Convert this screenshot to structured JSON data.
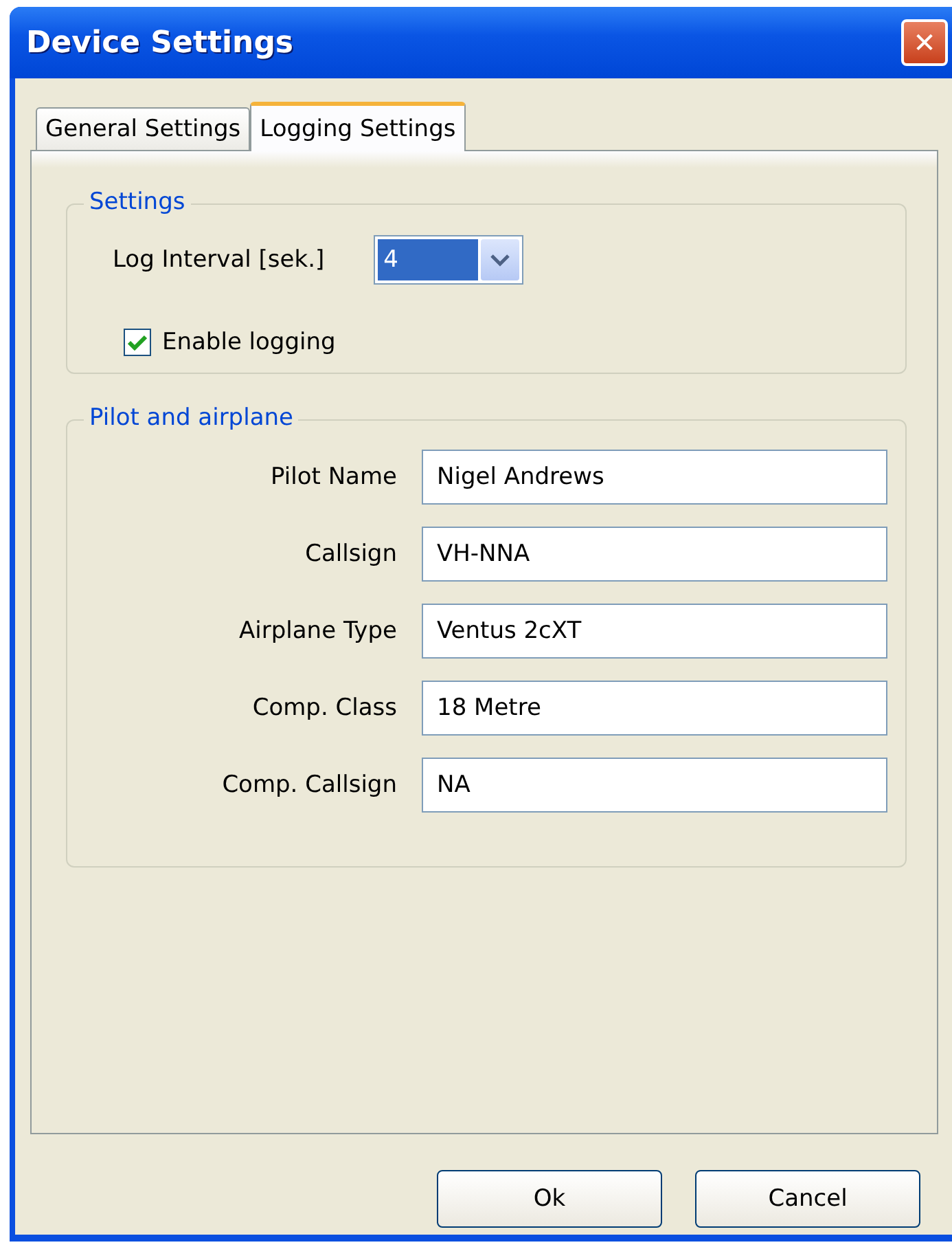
{
  "window": {
    "title": "Device Settings",
    "close": "✕"
  },
  "tabs": [
    {
      "label": "General Settings",
      "selected": false
    },
    {
      "label": "Logging Settings",
      "selected": true
    }
  ],
  "settings": {
    "title": "Settings",
    "log_interval": {
      "label": "Log Interval [sek.]",
      "value": "4"
    },
    "enable_logging": {
      "label": "Enable logging",
      "checked": true
    }
  },
  "pilot": {
    "title": "Pilot and airplane",
    "fields": [
      {
        "label": "Pilot Name",
        "value": "Nigel Andrews"
      },
      {
        "label": "Callsign",
        "value": "VH-NNA"
      },
      {
        "label": "Airplane Type",
        "value": "Ventus 2cXT"
      },
      {
        "label": "Comp. Class",
        "value": "18 Metre"
      },
      {
        "label": "Comp. Callsign",
        "value": "NA"
      }
    ]
  },
  "buttons": [
    "Ok",
    "Cancel"
  ]
}
